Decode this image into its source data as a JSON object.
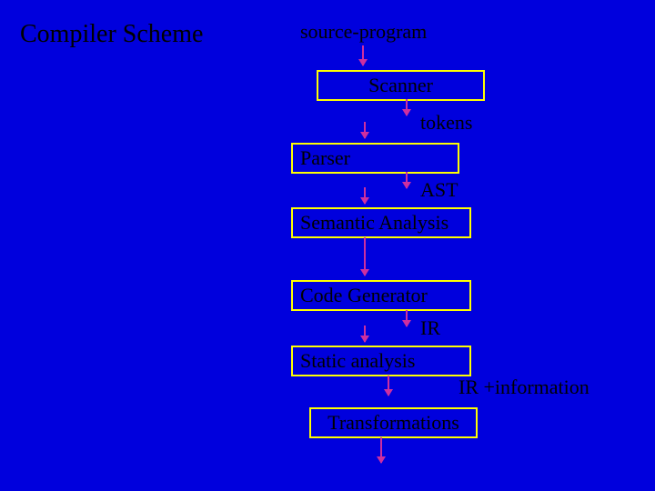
{
  "title": "Compiler Scheme",
  "labels": {
    "source": "source-program",
    "tokens": "tokens",
    "ast": "AST",
    "ir": "IR",
    "ir_info": "IR +information"
  },
  "boxes": {
    "scanner": "Scanner",
    "parser": "Parser",
    "semantic": "Semantic Analysis",
    "codegen": "Code Generator",
    "static": "Static analysis",
    "transforms": "Transformations"
  }
}
